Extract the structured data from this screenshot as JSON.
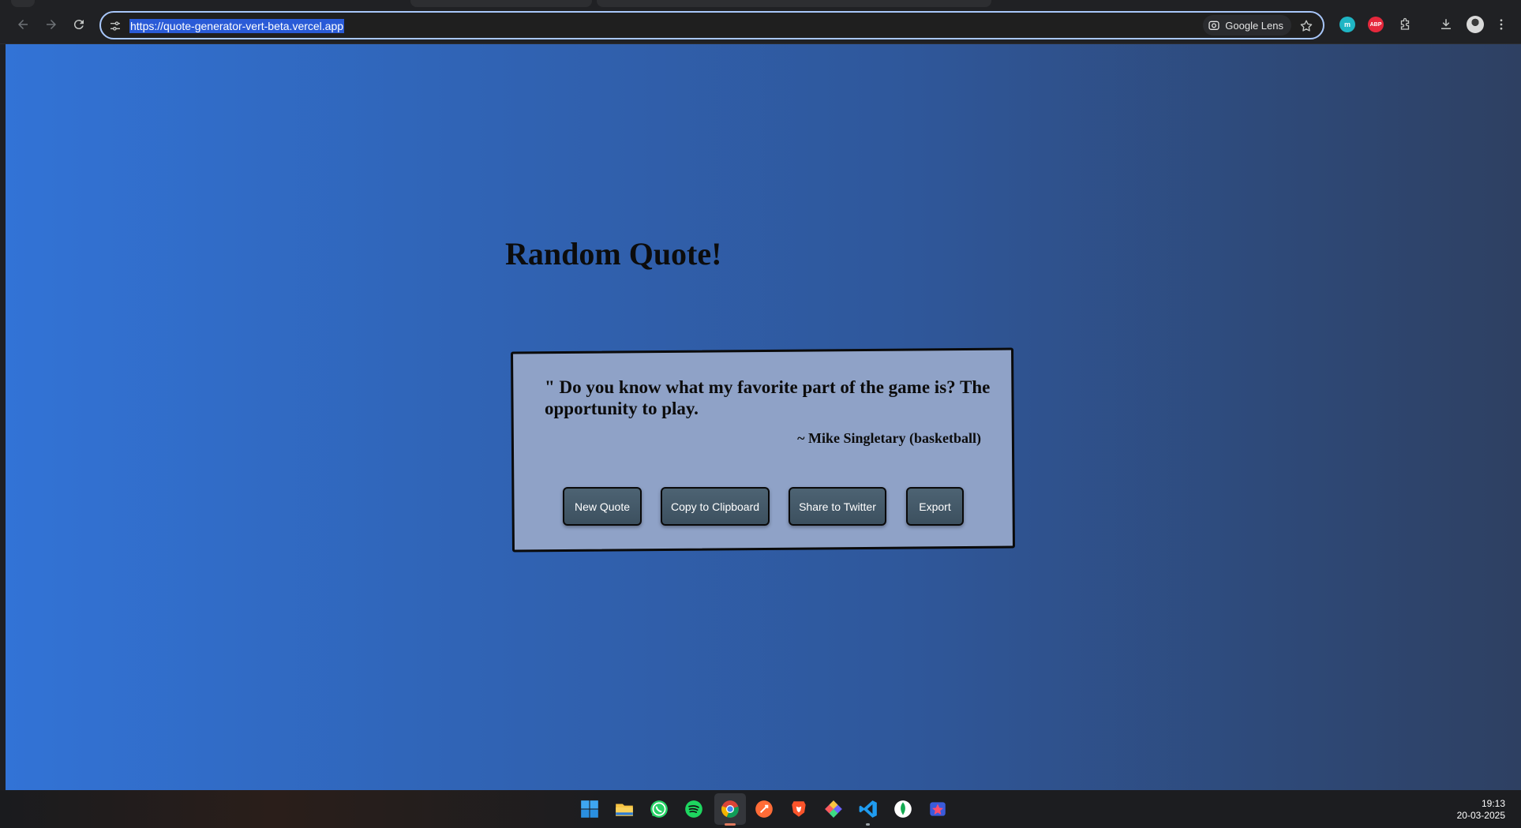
{
  "browser": {
    "url": "https://quote-generator-vert-beta.vercel.app",
    "lens_label": "Google Lens",
    "extensions": [
      {
        "name": "m",
        "color": "#1fb5c4"
      },
      {
        "name": "ABP",
        "color": "#e5283c"
      }
    ]
  },
  "page": {
    "title": "Random Quote!",
    "quote_text": "\" Do you know what my favorite part of the game is? The opportunity to play.",
    "quote_author": "~ Mike Singletary (basketball)",
    "buttons": {
      "new_quote": "New Quote",
      "copy": "Copy to Clipboard",
      "share": "Share to Twitter",
      "export": "Export"
    },
    "colors": {
      "gradient_start": "#3273d6",
      "gradient_end": "#2e4062",
      "card_background": "#8fa2c7",
      "button_background": "#44596a"
    }
  },
  "taskbar": {
    "apps": [
      "windows-start",
      "file-explorer",
      "whatsapp",
      "spotify",
      "chrome",
      "postman",
      "brave",
      "git-tool",
      "vscode",
      "mongodb-compass",
      "app-tool"
    ],
    "time": "19:13",
    "date": "20-03-2025"
  }
}
